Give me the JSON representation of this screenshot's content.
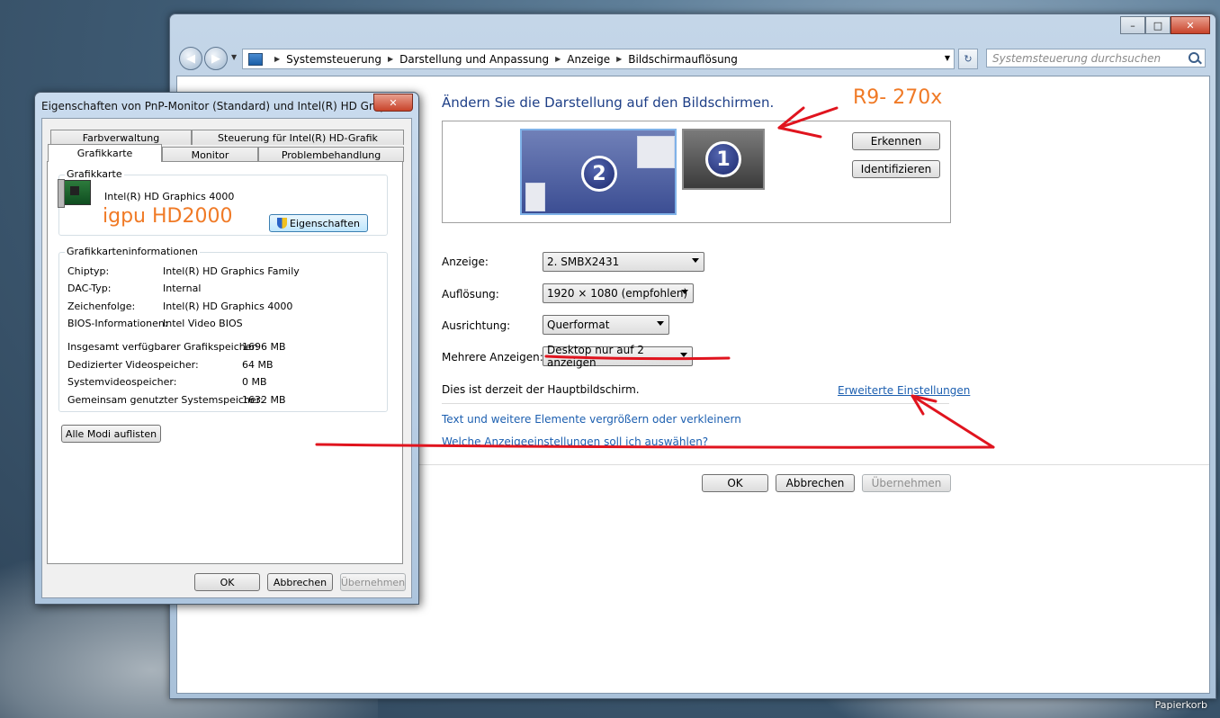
{
  "desktop": {
    "recycle_bin": "Papierkorb"
  },
  "window": {
    "breadcrumbs": [
      "Systemsteuerung",
      "Darstellung und Anpassung",
      "Anzeige",
      "Bildschirmauflösung"
    ],
    "search_placeholder": "Systemsteuerung durchsuchen",
    "caption": {
      "minimize": "–",
      "maximize": "□",
      "close": "✕"
    }
  },
  "main": {
    "title": "Ändern Sie die Darstellung auf den Bildschirmen.",
    "monitor_numbers": [
      "2",
      "1"
    ],
    "detect_button": "Erkennen",
    "identify_button": "Identifizieren",
    "fields": {
      "display_label": "Anzeige:",
      "display_value": "2. SMBX2431",
      "resolution_label": "Auflösung:",
      "resolution_value": "1920 × 1080 (empfohlen)",
      "orientation_label": "Ausrichtung:",
      "orientation_value": "Querformat",
      "multiple_label": "Mehrere Anzeigen:",
      "multiple_value": "Desktop nur auf 2 anzeigen"
    },
    "primary_text": "Dies ist derzeit der Hauptbildschirm.",
    "advanced_link": "Erweiterte Einstellungen",
    "link_text_size": "Text und weitere Elemente vergrößern oder verkleinern",
    "link_which_settings": "Welche Anzeigeeinstellungen soll ich auswählen?",
    "ok": "OK",
    "cancel": "Abbrechen",
    "apply": "Übernehmen"
  },
  "dialog": {
    "title": "Eigenschaften von PnP-Monitor (Standard) und Intel(R) HD Graphi...",
    "close": "✕",
    "tabs_row1": [
      "Farbverwaltung",
      "Steuerung für Intel(R) HD-Grafik"
    ],
    "tabs_row2": [
      "Grafikkarte",
      "Monitor",
      "Problembehandlung"
    ],
    "adapter_group": "Grafikkarte",
    "adapter_name": "Intel(R) HD Graphics 4000",
    "properties_button": "Eigenschaften",
    "info_group": "Grafikkarteninformationen",
    "info": [
      {
        "k": "Chiptyp:",
        "v": "Intel(R) HD Graphics Family"
      },
      {
        "k": "DAC-Typ:",
        "v": "Internal"
      },
      {
        "k": "Zeichenfolge:",
        "v": "Intel(R) HD Graphics 4000"
      },
      {
        "k": "BIOS-Informationen:",
        "v": "Intel Video BIOS"
      }
    ],
    "memory": [
      {
        "k": "Insgesamt verfügbarer Grafikspeicher:",
        "v": "1696 MB"
      },
      {
        "k": "Dedizierter Videospeicher:",
        "v": "64 MB"
      },
      {
        "k": "Systemvideospeicher:",
        "v": "0 MB"
      },
      {
        "k": "Gemeinsam genutzter Systemspeicher:",
        "v": "1632 MB"
      }
    ],
    "list_modes_button": "Alle Modi auflisten",
    "ok": "OK",
    "cancel": "Abbrechen",
    "apply": "Übernehmen"
  },
  "annotations": {
    "r9": "R9- 270x",
    "igpu": "igpu HD2000"
  }
}
